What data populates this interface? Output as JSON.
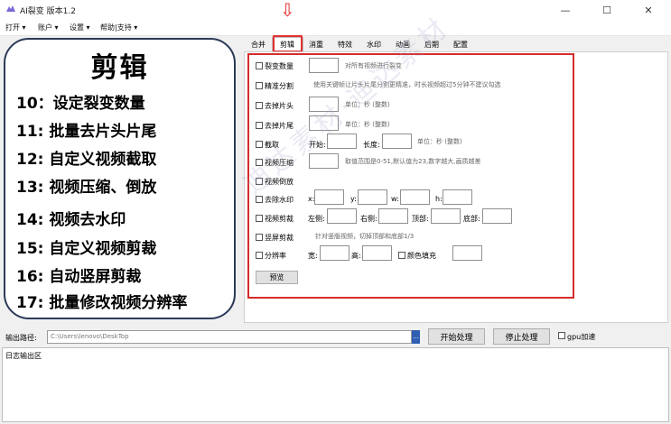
{
  "window": {
    "title": "AI裂变  版本1.2",
    "minimize": "—",
    "maximize": "☐",
    "close": "✕"
  },
  "menu": [
    "打开 ▾",
    "账户 ▾",
    "设置 ▾",
    "帮助|支持 ▾"
  ],
  "left_panel": {
    "title": "剪辑",
    "features": [
      "10：设定裂变数量",
      "11: 批量去片头片尾",
      "12: 自定义视频截取",
      "13: 视频压缩、倒放",
      "14: 视频去水印",
      "15: 自定义视频剪裁",
      "16: 自动竖屏剪裁",
      "17: 批量修改视频分辨率"
    ]
  },
  "tabs": [
    "合并",
    "剪辑",
    "消重",
    "特效",
    "水印",
    "动画",
    "后期",
    "配置"
  ],
  "indicator_arrow": "⇩",
  "form": {
    "fission_count": {
      "label": "裂变数量",
      "hint": "对所有视频进行裂变"
    },
    "precise_split": {
      "label": "精准分割",
      "hint": "使用关键帧让片头片尾分割更精准，时长视频超过5分钟不建议勾选"
    },
    "cut_head": {
      "label": "去掉片头",
      "unit": "单位：秒 (整数)"
    },
    "cut_tail": {
      "label": "去掉片尾",
      "unit": "单位：秒 (整数)"
    },
    "clip": {
      "label": "截取",
      "start": "开始:",
      "length": "长度:",
      "unit": "单位：秒 (整数)"
    },
    "compress": {
      "label": "视频压缩",
      "hint": "取值范围是0-51,默认值为23,数字越大,画质越差"
    },
    "reverse": {
      "label": "视频倒放"
    },
    "remove_watermark": {
      "label": "去除水印",
      "x": "x:",
      "y": "y:",
      "w": "w:",
      "h": "h:"
    },
    "crop": {
      "label": "视频剪裁",
      "left": "左侧:",
      "right": "右侧:",
      "top": "顶部:",
      "bottom": "底部:"
    },
    "vertical_crop": {
      "label": "竖屏剪裁",
      "hint": "针对竖版视频，切掉顶部和底部1/3"
    },
    "resolution": {
      "label": "分辨率",
      "width": "宽:",
      "height": "高:",
      "color_fill": "颜色填充"
    },
    "preview_button": "预览"
  },
  "bottom": {
    "output_label": "输出路径:",
    "output_path": "C:\\Users\\lenovo\\DeskTop",
    "browse": "...",
    "start_button": "开始处理",
    "stop_button": "停止处理",
    "gpu_label": "gpu加速",
    "log_label": "日志输出区"
  },
  "watermark_text": "迪达素材·迪达素材"
}
